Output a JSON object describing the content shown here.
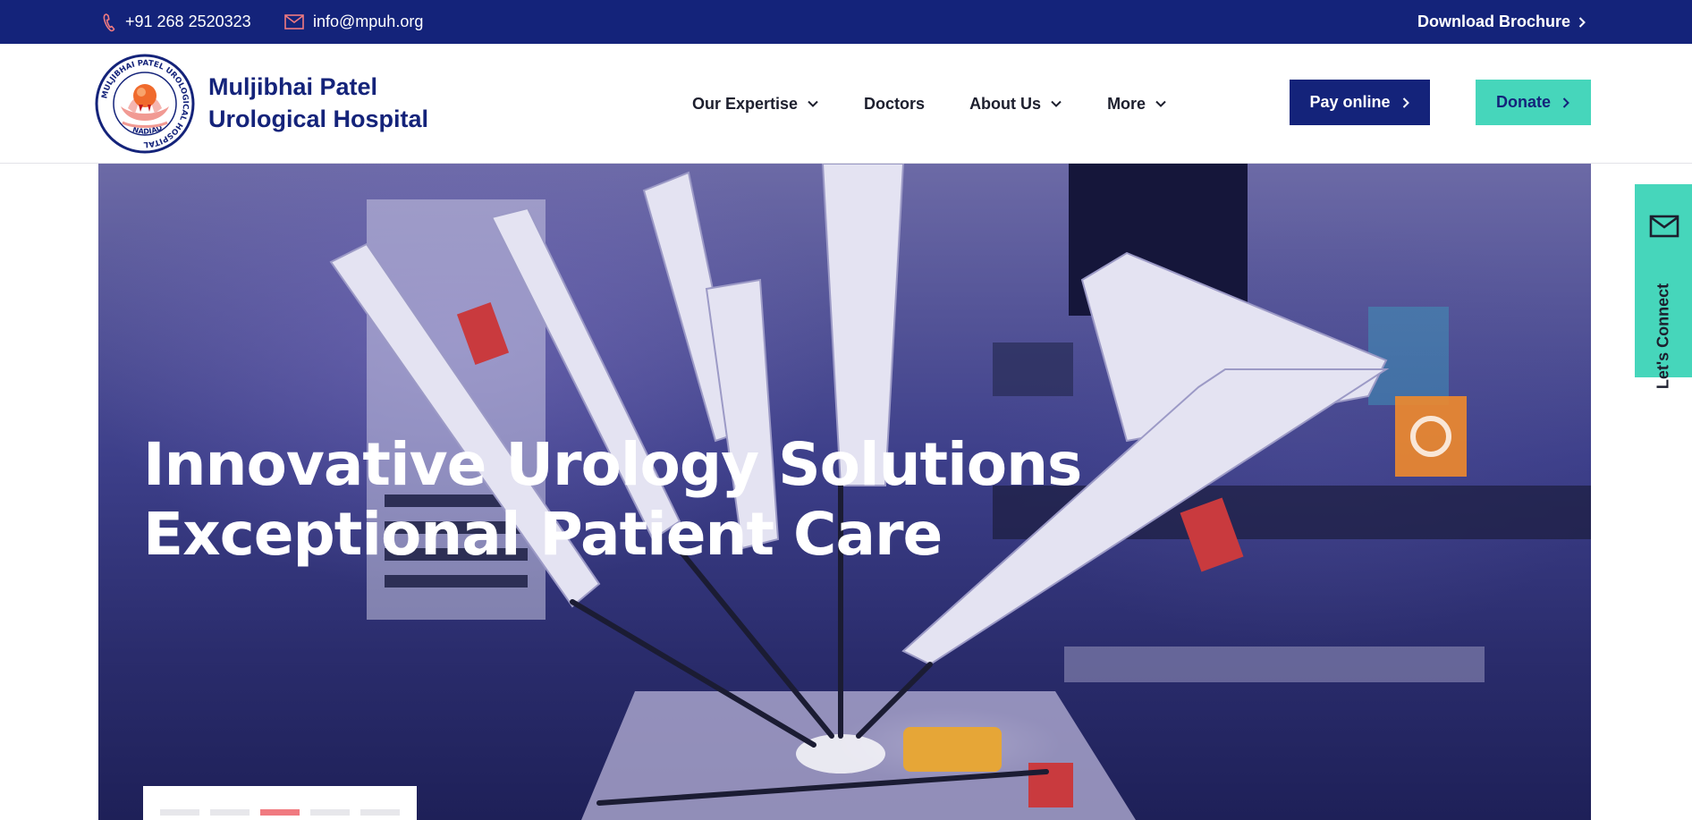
{
  "topbar": {
    "phone": "+91 268 2520323",
    "email": "info@mpuh.org",
    "brochure_label": "Download Brochure"
  },
  "header": {
    "brand_line1": "Muljibhai Patel",
    "brand_line2": "Urological Hospital",
    "logo_ring_text": "MULJIBHAI PATEL UROLOGICAL HOSPITAL",
    "logo_bottom_text": "NADIAD",
    "nav": [
      {
        "label": "Our Expertise",
        "has_dropdown": true
      },
      {
        "label": "Doctors",
        "has_dropdown": false
      },
      {
        "label": "About Us",
        "has_dropdown": true
      },
      {
        "label": "More",
        "has_dropdown": true
      }
    ],
    "pay_label": "Pay online",
    "donate_label": "Donate"
  },
  "hero": {
    "title_bold": "Innovative",
    "title_rest": " Urology Solutions",
    "title_line2": "Exceptional Patient Care",
    "slides_total": 5,
    "active_slide": 3
  },
  "side_tab": {
    "label": "Let's Connect",
    "icon": "mail-icon"
  },
  "colors": {
    "navy": "#14237a",
    "teal": "#46d6bb",
    "accent_pink": "#f07a80"
  }
}
